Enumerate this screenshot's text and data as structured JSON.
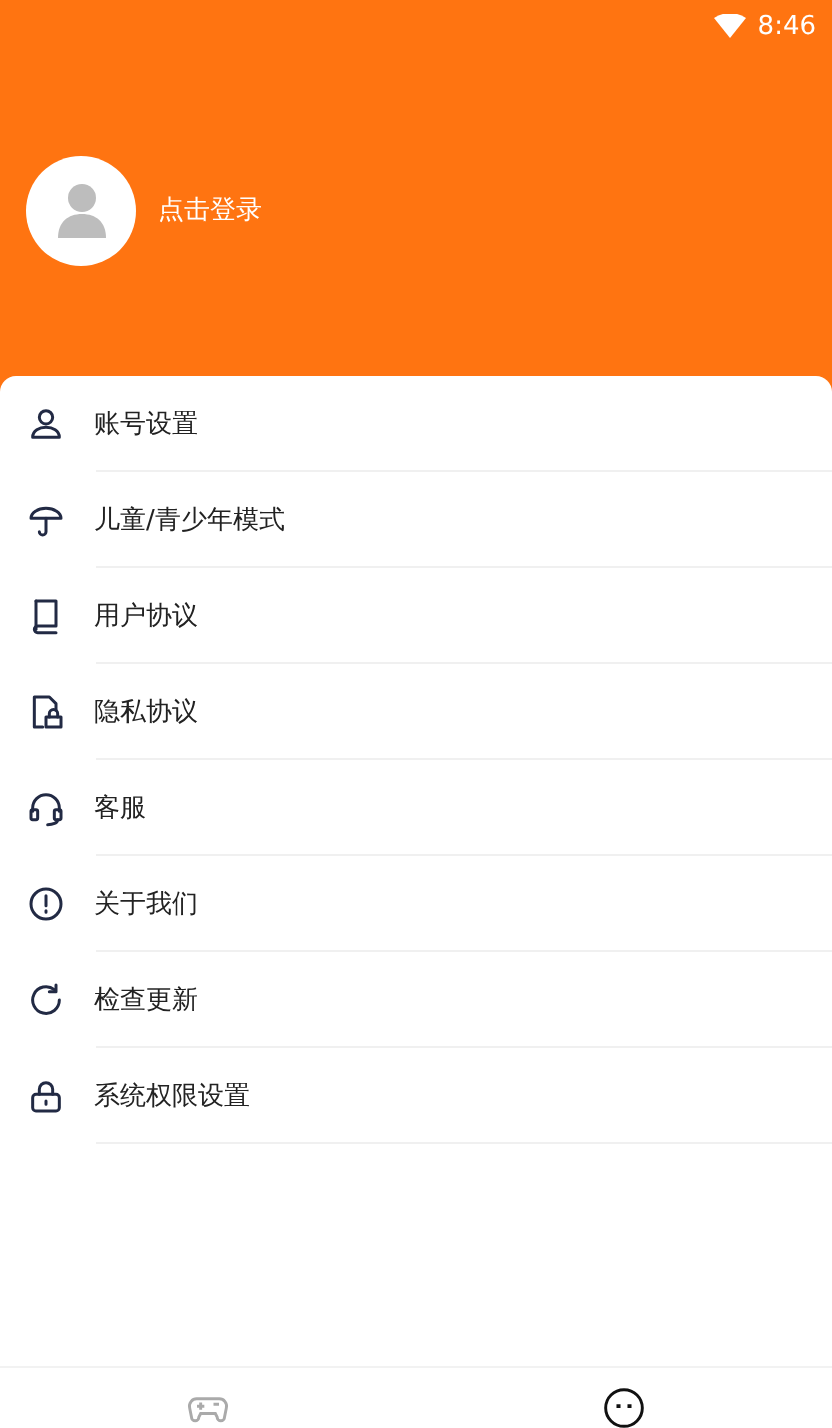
{
  "status_bar": {
    "time": "8:46"
  },
  "profile": {
    "login_label": "点击登录"
  },
  "menu": [
    {
      "label": "账号设置"
    },
    {
      "label": "儿童/青少年模式"
    },
    {
      "label": "用户协议"
    },
    {
      "label": "隐私协议"
    },
    {
      "label": "客服"
    },
    {
      "label": "关于我们"
    },
    {
      "label": "检查更新"
    },
    {
      "label": "系统权限设置"
    }
  ],
  "bottom_nav": [
    {
      "selected": false
    },
    {
      "selected": true
    }
  ]
}
